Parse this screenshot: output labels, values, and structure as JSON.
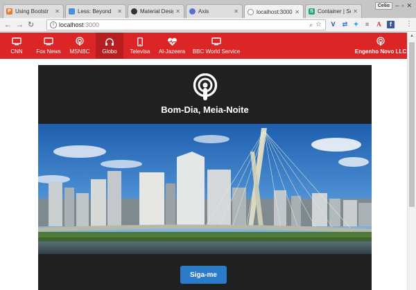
{
  "browser": {
    "tabs": [
      {
        "title": "Using Bootstr",
        "fav_color": "#e8782a",
        "fav_glyph": "P",
        "active": false
      },
      {
        "title": "Less: Beyond",
        "fav_color": "#4a90d9",
        "fav_glyph": "",
        "active": false
      },
      {
        "title": "Material Desig",
        "fav_color": "#333333",
        "fav_glyph": "",
        "active": false
      },
      {
        "title": "Axis",
        "fav_color": "#5a6fd6",
        "fav_glyph": "",
        "active": false
      },
      {
        "title": "localhost:3000",
        "fav_color": "#888888",
        "fav_glyph": "",
        "active": true
      },
      {
        "title": "Container | Se",
        "fav_color": "#1fa67a",
        "fav_glyph": "S",
        "active": false
      }
    ],
    "profile": "Celio",
    "url_host": "localhost",
    "url_port": ":3000"
  },
  "navbar": {
    "items": [
      {
        "label": "CNN",
        "icon": "tv-icon"
      },
      {
        "label": "Fox News",
        "icon": "tv-icon"
      },
      {
        "label": "MSNBC",
        "icon": "podcast-icon"
      },
      {
        "label": "Globo",
        "icon": "headphones-icon",
        "active": true
      },
      {
        "label": "Televisa",
        "icon": "phone-icon"
      },
      {
        "label": "Al-Jazeera",
        "icon": "heartbeat-icon"
      },
      {
        "label": "BBC World Service",
        "icon": "tv-icon"
      }
    ],
    "brand": {
      "label": "Engenho Novo LLC",
      "icon": "podcast-icon"
    }
  },
  "card": {
    "title": "Bom-Dia, Meia-Noite",
    "button": "Siga-me"
  },
  "colors": {
    "navbar": "#dc2526",
    "navbar_active": "#b81e1f",
    "card": "#1f2022",
    "button": "#2b7bc8"
  }
}
